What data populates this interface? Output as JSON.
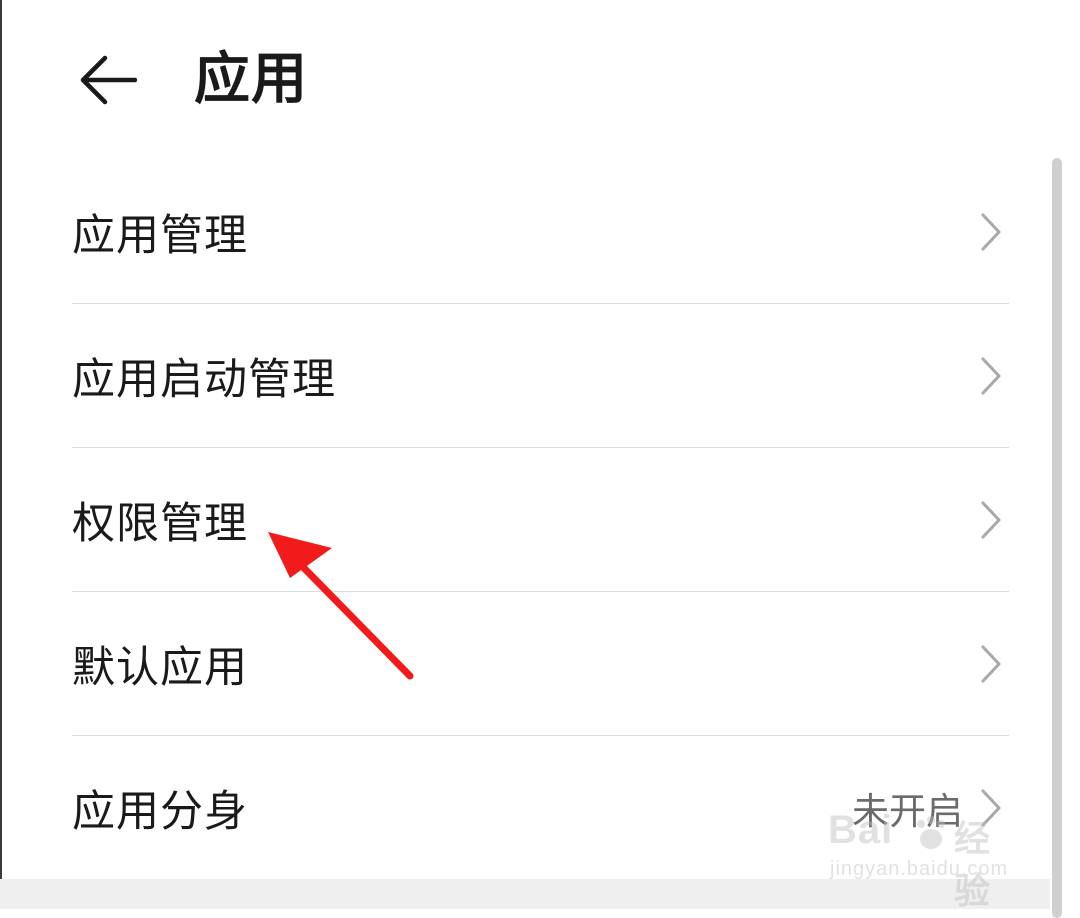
{
  "header": {
    "title": "应用",
    "back_icon": "arrow-left-icon"
  },
  "items": [
    {
      "label": "应用管理",
      "value": ""
    },
    {
      "label": "应用启动管理",
      "value": ""
    },
    {
      "label": "权限管理",
      "value": ""
    },
    {
      "label": "默认应用",
      "value": ""
    },
    {
      "label": "应用分身",
      "value": "未开启"
    }
  ],
  "icons": {
    "chevron": "chevron-right-icon",
    "annotation": "red-arrow-icon"
  },
  "colors": {
    "annotation_arrow": "#f21a1a",
    "chevron": "#a8a8a8",
    "divider": "#dcdcdc"
  },
  "watermark": {
    "brand": "Bai",
    "brand_cn": "经验",
    "url": "jingyan.baidu.com"
  }
}
